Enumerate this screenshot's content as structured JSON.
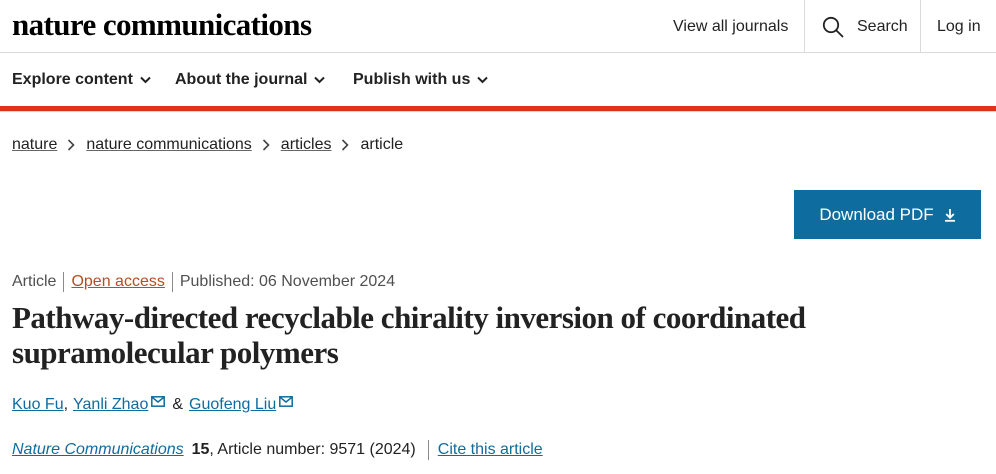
{
  "header": {
    "logo": "nature communications",
    "view_all_journals": "View all journals",
    "search_label": "Search",
    "login_label": "Log in"
  },
  "nav": {
    "items": [
      {
        "label": "Explore content"
      },
      {
        "label": "About the journal"
      },
      {
        "label": "Publish with us"
      }
    ]
  },
  "accent_color": "#e0301e",
  "link_color": "#0f6c9e",
  "breadcrumb": {
    "items": [
      "nature",
      "nature communications",
      "articles"
    ],
    "current": "article"
  },
  "download_button": {
    "label": "Download PDF",
    "icon": "download-icon"
  },
  "article": {
    "type": "Article",
    "access": "Open access",
    "published": "Published: 06 November 2024",
    "title": "Pathway-directed recyclable chirality inversion of coordinated supramolecular polymers",
    "authors": [
      {
        "name": "Kuo Fu",
        "email_icon": false
      },
      {
        "name": "Yanli Zhao",
        "email_icon": true
      },
      {
        "name": "Guofeng Liu",
        "email_icon": true
      }
    ],
    "author_separator_1": ",",
    "author_separator_2": "&",
    "journal": "Nature Communications",
    "volume": "15",
    "article_number": ", Article number: 9571 (2024)",
    "cite_label": "Cite this article"
  }
}
